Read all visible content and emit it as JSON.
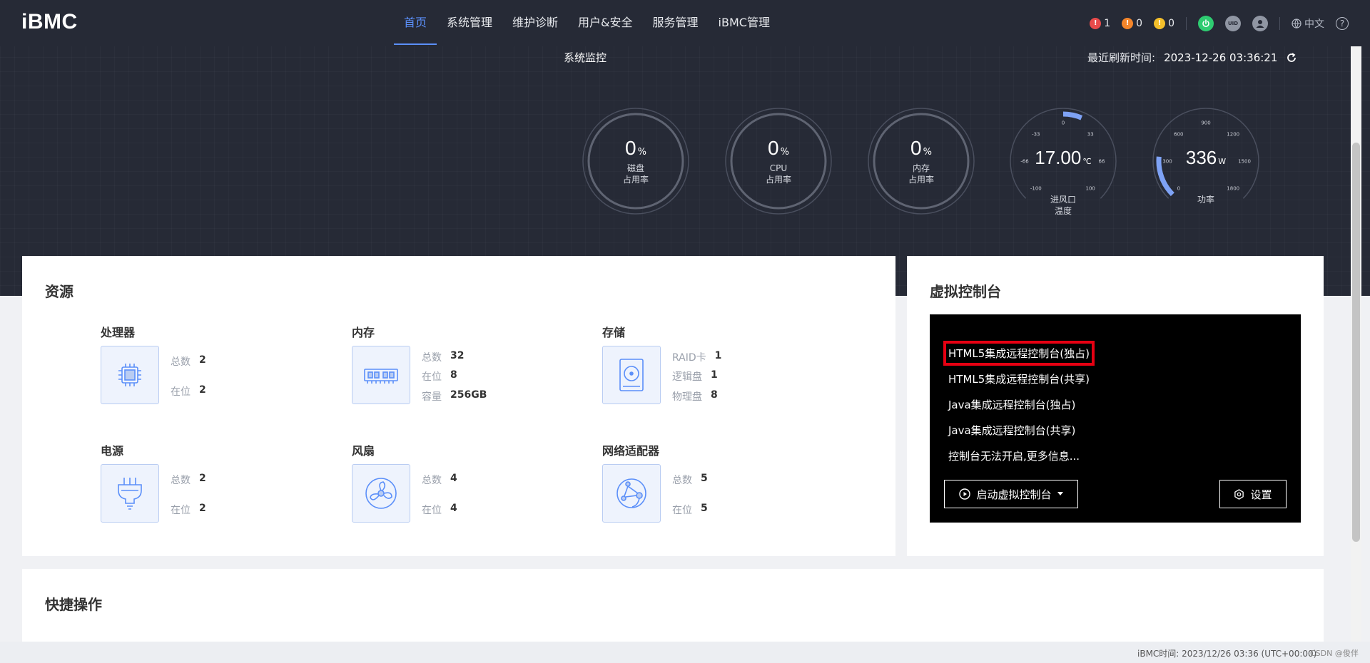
{
  "header": {
    "logo": "iBMC",
    "nav": [
      "首页",
      "系统管理",
      "维护诊断",
      "用户&安全",
      "服务管理",
      "iBMC管理"
    ],
    "alarms": [
      {
        "count": "1",
        "color": "#e94b4b"
      },
      {
        "count": "0",
        "color": "#f5862b"
      },
      {
        "count": "0",
        "color": "#f5c02b"
      }
    ],
    "power_icon": "power-icon",
    "uid_label": "UID",
    "language": "中文",
    "help": "?"
  },
  "monitor": {
    "title": "系统监控",
    "refresh_label": "最近刷新时间:",
    "refresh_time": "2023-12-26 03:36:21",
    "gauges": [
      {
        "value": "0",
        "unit": "%",
        "label1": "磁盘",
        "label2": "占用率"
      },
      {
        "value": "0",
        "unit": "%",
        "label1": "CPU",
        "label2": "占用率"
      },
      {
        "value": "0",
        "unit": "%",
        "label1": "内存",
        "label2": "占用率"
      }
    ],
    "temperature": {
      "value": "17.00",
      "unit": "℃",
      "label1": "进风口",
      "label2": "温度",
      "ticks": [
        "-100",
        "-66",
        "-33",
        "0",
        "33",
        "66",
        "100"
      ],
      "level": 17
    },
    "power": {
      "value": "336",
      "unit": "W",
      "label1": "功率",
      "ticks": [
        "0",
        "300",
        "600",
        "900",
        "1200",
        "1500",
        "1800"
      ],
      "level": 336
    }
  },
  "resources": {
    "title": "资源",
    "items": [
      {
        "name": "处理器",
        "kv": [
          {
            "k": "总数",
            "v": "2"
          },
          {
            "k": "在位",
            "v": "2"
          }
        ]
      },
      {
        "name": "内存",
        "kv": [
          {
            "k": "总数",
            "v": "32"
          },
          {
            "k": "在位",
            "v": "8"
          },
          {
            "k": "容量",
            "v": "256GB"
          }
        ]
      },
      {
        "name": "存储",
        "kv": [
          {
            "k": "RAID卡",
            "v": "1"
          },
          {
            "k": "逻辑盘",
            "v": "1"
          },
          {
            "k": "物理盘",
            "v": "8"
          }
        ]
      },
      {
        "name": "电源",
        "kv": [
          {
            "k": "总数",
            "v": "2"
          },
          {
            "k": "在位",
            "v": "2"
          }
        ]
      },
      {
        "name": "风扇",
        "kv": [
          {
            "k": "总数",
            "v": "4"
          },
          {
            "k": "在位",
            "v": "4"
          }
        ]
      },
      {
        "name": "网络适配器",
        "kv": [
          {
            "k": "总数",
            "v": "5"
          },
          {
            "k": "在位",
            "v": "5"
          }
        ]
      }
    ]
  },
  "console": {
    "title": "虚拟控制台",
    "links": [
      "HTML5集成远程控制台(独占)",
      "HTML5集成远程控制台(共享)",
      "Java集成远程控制台(独占)",
      "Java集成远程控制台(共享)",
      "控制台无法开启,更多信息..."
    ],
    "launch_label": "启动虚拟控制台",
    "settings_label": "设置"
  },
  "quick_ops": {
    "title": "快捷操作"
  },
  "footer": {
    "time": "iBMC时间: 2023/12/26 03:36 (UTC+00:00)",
    "watermark": "CSDN @俊伴"
  },
  "colors": {
    "accent": "#5b8ff9",
    "dark": "#262a36",
    "highlight": "#e60012"
  }
}
